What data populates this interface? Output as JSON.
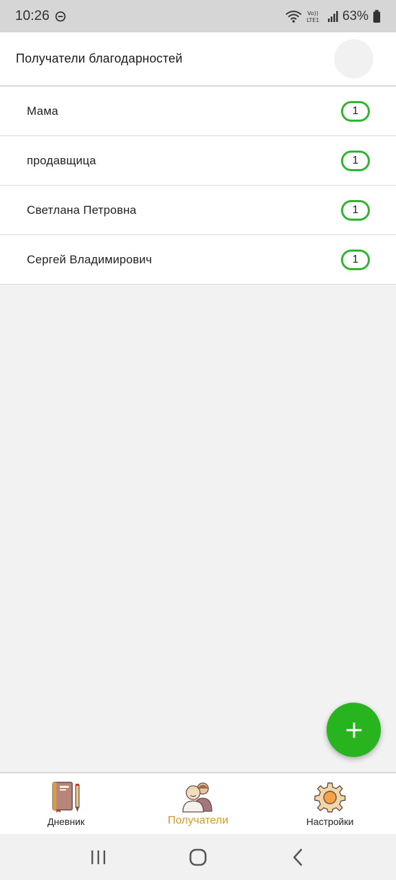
{
  "status_bar": {
    "time": "10:26",
    "battery": "63%",
    "dnd_icon": "do-not-disturb-icon",
    "wifi_icon": "wifi-icon",
    "volte_label": "Vo)) LTE1",
    "signal_icon": "signal-icon",
    "battery_icon": "battery-icon"
  },
  "header": {
    "title": "Получатели благодарностей"
  },
  "recipients": [
    {
      "name": "Мама",
      "count": "1"
    },
    {
      "name": "продавщица",
      "count": "1"
    },
    {
      "name": "Светлана Петровна",
      "count": "1"
    },
    {
      "name": "Сергей Владимирович",
      "count": "1"
    }
  ],
  "fab": {
    "icon": "plus-icon"
  },
  "bottom_nav": {
    "items": [
      {
        "label": "Дневник",
        "icon": "diary-icon"
      },
      {
        "label": "Получатели",
        "icon": "recipients-icon",
        "active": true
      },
      {
        "label": "Настройки",
        "icon": "settings-gear-icon"
      }
    ]
  },
  "colors": {
    "accent_green": "#27b41f",
    "badge_border": "#2db52d",
    "active_tab": "#d69a21"
  }
}
